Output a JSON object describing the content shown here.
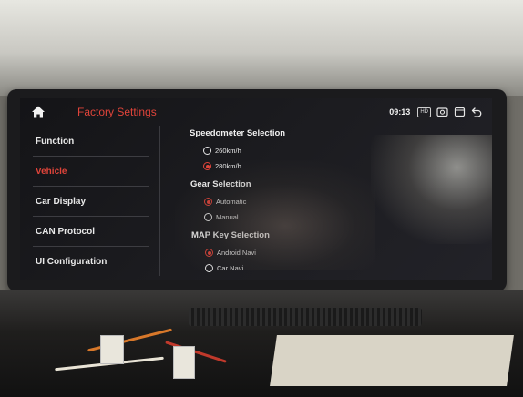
{
  "header": {
    "title": "Factory Settings",
    "time": "09:13",
    "hd_badge": "HD"
  },
  "icons": {
    "home": "home-icon",
    "screenshot": "camera-icon",
    "window": "window-icon",
    "back": "back-arrow-icon"
  },
  "colors": {
    "accent": "#e0443a",
    "background": "#18181c",
    "text": "#e9e9e9"
  },
  "sidebar": {
    "items": [
      {
        "label": "Function",
        "active": false
      },
      {
        "label": "Vehicle",
        "active": true
      },
      {
        "label": "Car Display",
        "active": false
      },
      {
        "label": "CAN Protocol",
        "active": false
      },
      {
        "label": "UI Configuration",
        "active": false
      }
    ]
  },
  "sections": {
    "speedometer": {
      "title": "Speedometer Selection",
      "options": [
        {
          "label": "260km/h",
          "selected": false
        },
        {
          "label": "280km/h",
          "selected": true
        }
      ]
    },
    "gear": {
      "title": "Gear Selection",
      "options": [
        {
          "label": "Automatic",
          "selected": true
        },
        {
          "label": "Manual",
          "selected": false
        }
      ]
    },
    "map_key": {
      "title": "MAP Key Selection",
      "options": [
        {
          "label": "Android Navi",
          "selected": true
        },
        {
          "label": "Car Navi",
          "selected": false
        }
      ]
    }
  }
}
